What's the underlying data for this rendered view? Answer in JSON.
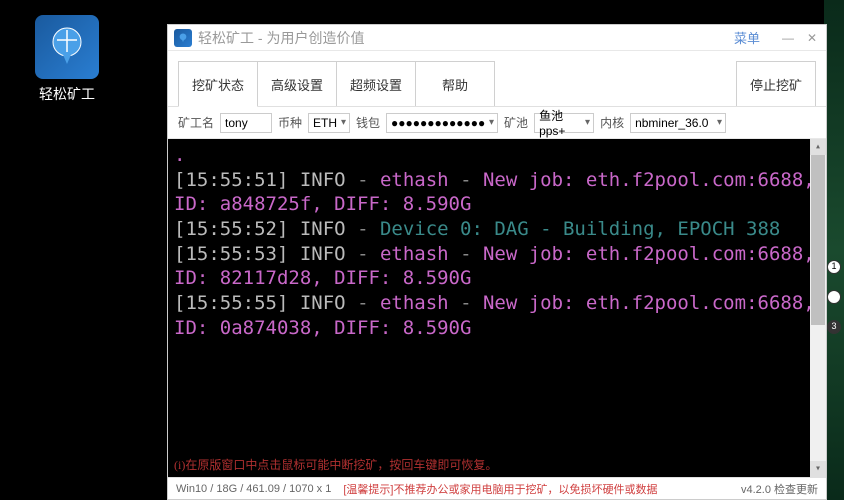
{
  "desktopIcon": {
    "label": "轻松矿工"
  },
  "window": {
    "title": "轻松矿工 - 为用户创造价值",
    "menuButton": "菜单",
    "tabs": {
      "mining_status": "挖矿状态",
      "advanced": "高级设置",
      "overclock": "超频设置",
      "help": "帮助"
    },
    "stopButton": "停止挖矿"
  },
  "params": {
    "workerLabel": "矿工名",
    "workerName": "tony",
    "coinLabel": "币种",
    "coin": "ETH",
    "walletLabel": "钱包",
    "wallet": "●●●●●●●●●●●●●",
    "poolLabel": "矿池",
    "pool": "鱼池pps+",
    "kernelLabel": "内核",
    "kernel": "nbminer_36.0"
  },
  "console": {
    "lines": [
      {
        "ts": "[15:55:51]",
        "lvl": "INFO",
        "msg1": "ethash",
        "msg2": "New job: eth.f2pool.com:6688, ID: a848725f, DIFF: 8.590G"
      },
      {
        "ts": "[15:55:52]",
        "lvl": "INFO",
        "msg_cyan": "Device 0: DAG - Building, EPOCH 388"
      },
      {
        "ts": "[15:55:53]",
        "lvl": "INFO",
        "msg1": "ethash",
        "msg2": "New job: eth.f2pool.com:6688, ID: 82117d28, DIFF: 8.590G"
      },
      {
        "ts": "[15:55:55]",
        "lvl": "INFO",
        "msg1": "ethash",
        "msg2": "New job: eth.f2pool.com:6688, ID: 0a874038, DIFF: 8.590G"
      }
    ],
    "hint": "(i)在原版窗口中点击鼠标可能中断挖矿，按回车键即可恢复。"
  },
  "statusbar": {
    "sys": "Win10  /  18G / 461.09  /  1070 x 1",
    "warn": "[温馨提示]不推荐办公或家用电脑用于挖矿，以免损坏硬件或数据",
    "ver": "v4.2.0 检查更新"
  }
}
